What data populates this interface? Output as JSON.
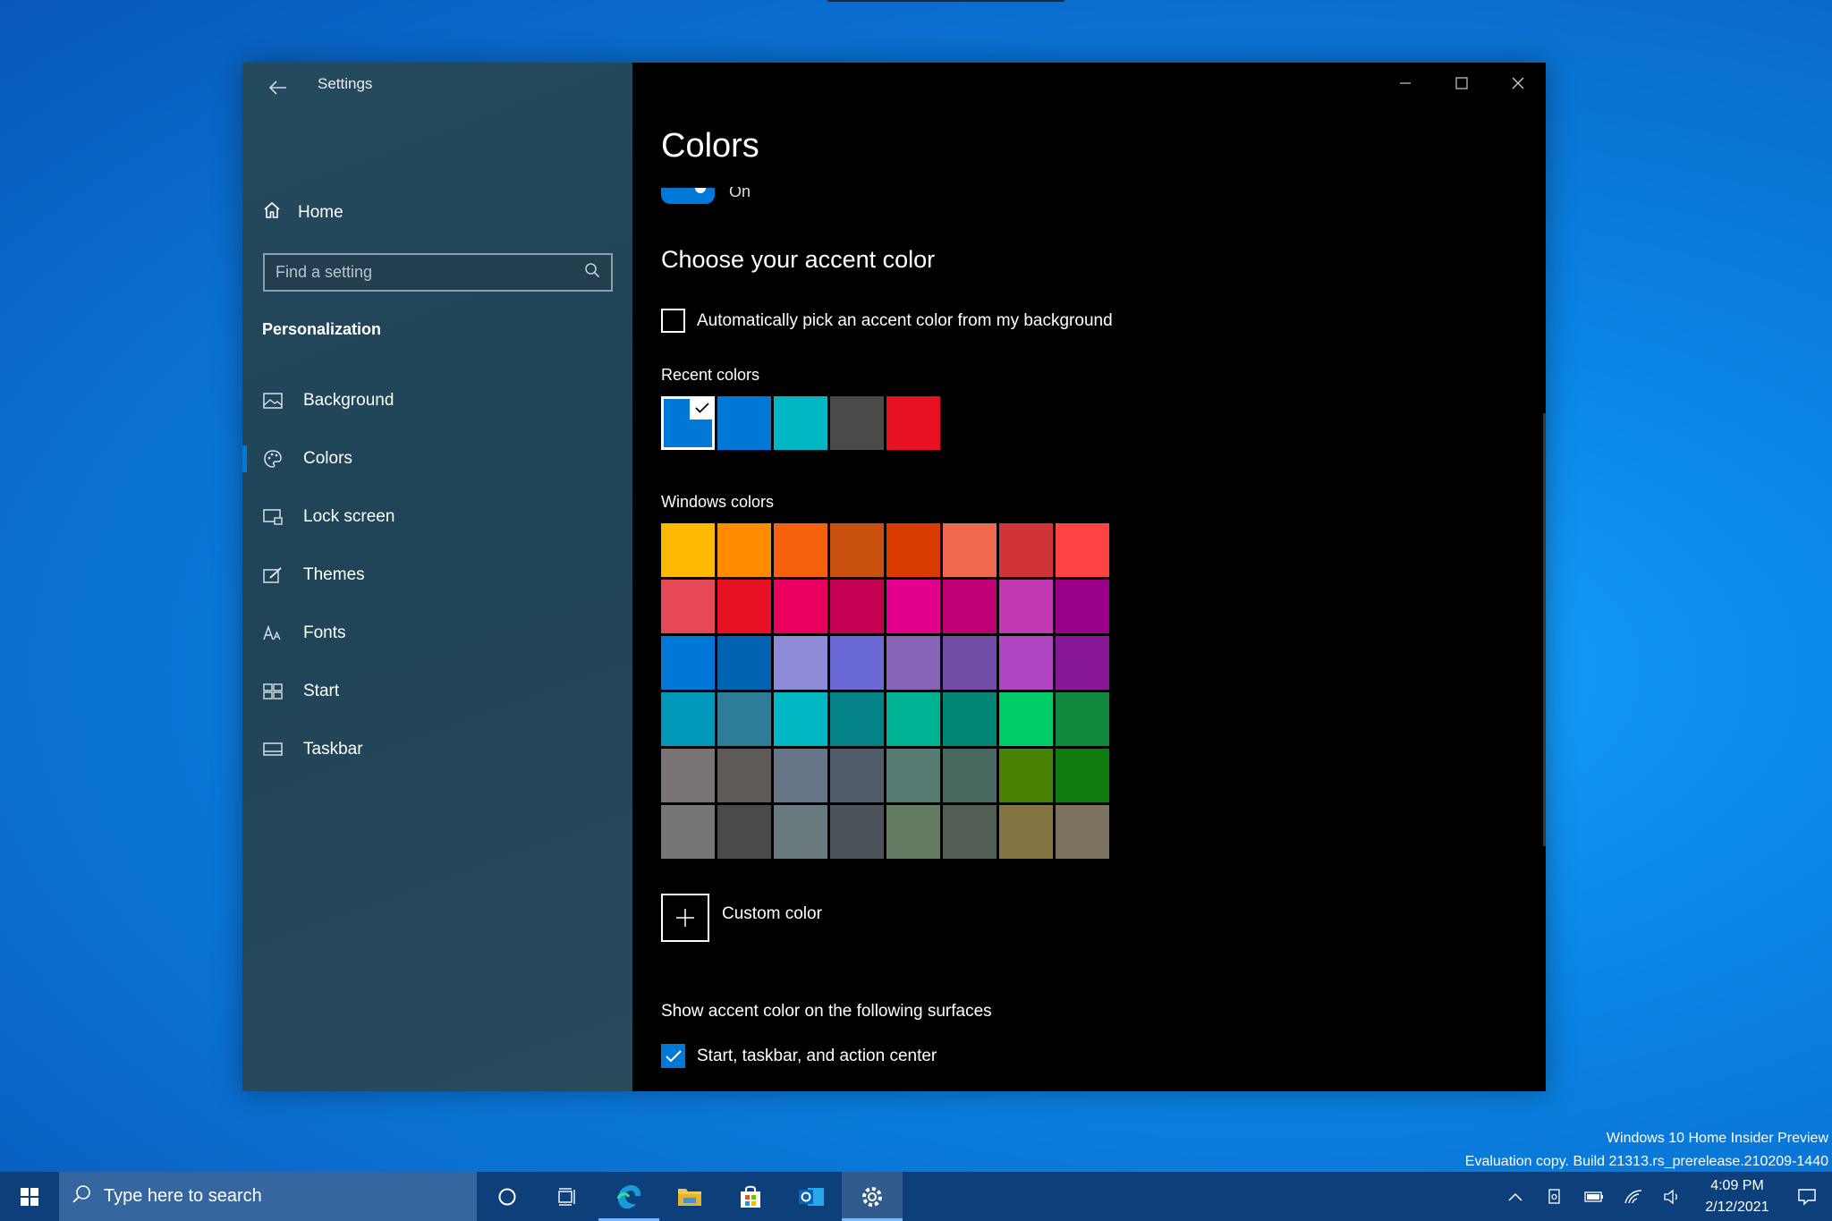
{
  "window": {
    "title": "Settings",
    "controls": {
      "minimize": "─",
      "maximize": "☐",
      "close": "✕"
    }
  },
  "sidebar": {
    "back_icon": "back-arrow-icon",
    "home_label": "Home",
    "search_placeholder": "Find a setting",
    "section_title": "Personalization",
    "items": [
      {
        "label": "Background",
        "icon": "picture-icon",
        "active": false
      },
      {
        "label": "Colors",
        "icon": "palette-icon",
        "active": true
      },
      {
        "label": "Lock screen",
        "icon": "lock-screen-icon",
        "active": false
      },
      {
        "label": "Themes",
        "icon": "brush-icon",
        "active": false
      },
      {
        "label": "Fonts",
        "icon": "fonts-icon",
        "active": false
      },
      {
        "label": "Start",
        "icon": "start-icon",
        "active": false
      },
      {
        "label": "Taskbar",
        "icon": "taskbar-icon",
        "active": false
      }
    ]
  },
  "main": {
    "page_title": "Colors",
    "toggle_label": "On",
    "heading": "Choose your accent color",
    "auto_pick_label": "Automatically pick an accent color from my background",
    "auto_pick_checked": false,
    "recent_label": "Recent colors",
    "recent_colors": [
      "#0078d7",
      "#0078d7",
      "#00b7c3",
      "#4c4a48",
      "#e81123"
    ],
    "recent_selected_index": 0,
    "windows_label": "Windows colors",
    "windows_colors": [
      "#ffb900",
      "#ff8c00",
      "#f7630c",
      "#ca5010",
      "#da3b01",
      "#ef6950",
      "#d13438",
      "#ff4343",
      "#e74856",
      "#e81123",
      "#ea005e",
      "#c30052",
      "#e3008c",
      "#bf0077",
      "#c239b3",
      "#9a0089",
      "#0078d7",
      "#0063b1",
      "#8e8cd8",
      "#6b69d6",
      "#8764b8",
      "#744da9",
      "#b146c2",
      "#881798",
      "#0099bc",
      "#2d7d9a",
      "#00b7c3",
      "#038387",
      "#00b294",
      "#018574",
      "#00cc6a",
      "#10893e",
      "#7a7574",
      "#5d5a58",
      "#68768a",
      "#515c6b",
      "#567c73",
      "#486860",
      "#498205",
      "#107c10",
      "#767676",
      "#4c4a48",
      "#69797e",
      "#4a5459",
      "#647c64",
      "#525e54",
      "#847545",
      "#7e735f"
    ],
    "custom_color_label": "Custom color",
    "surfaces_label": "Show accent color on the following surfaces",
    "surfaces_option_label": "Start, taskbar, and action center",
    "surfaces_option_checked": true
  },
  "watermark": {
    "line1": "Windows 10 Home Insider Preview",
    "line2": "Evaluation copy. Build 21313.rs_prerelease.210209-1440"
  },
  "taskbar": {
    "search_placeholder": "Type here to search",
    "time": "4:09 PM",
    "date": "2/12/2021",
    "accent": "#0d3f7a"
  }
}
